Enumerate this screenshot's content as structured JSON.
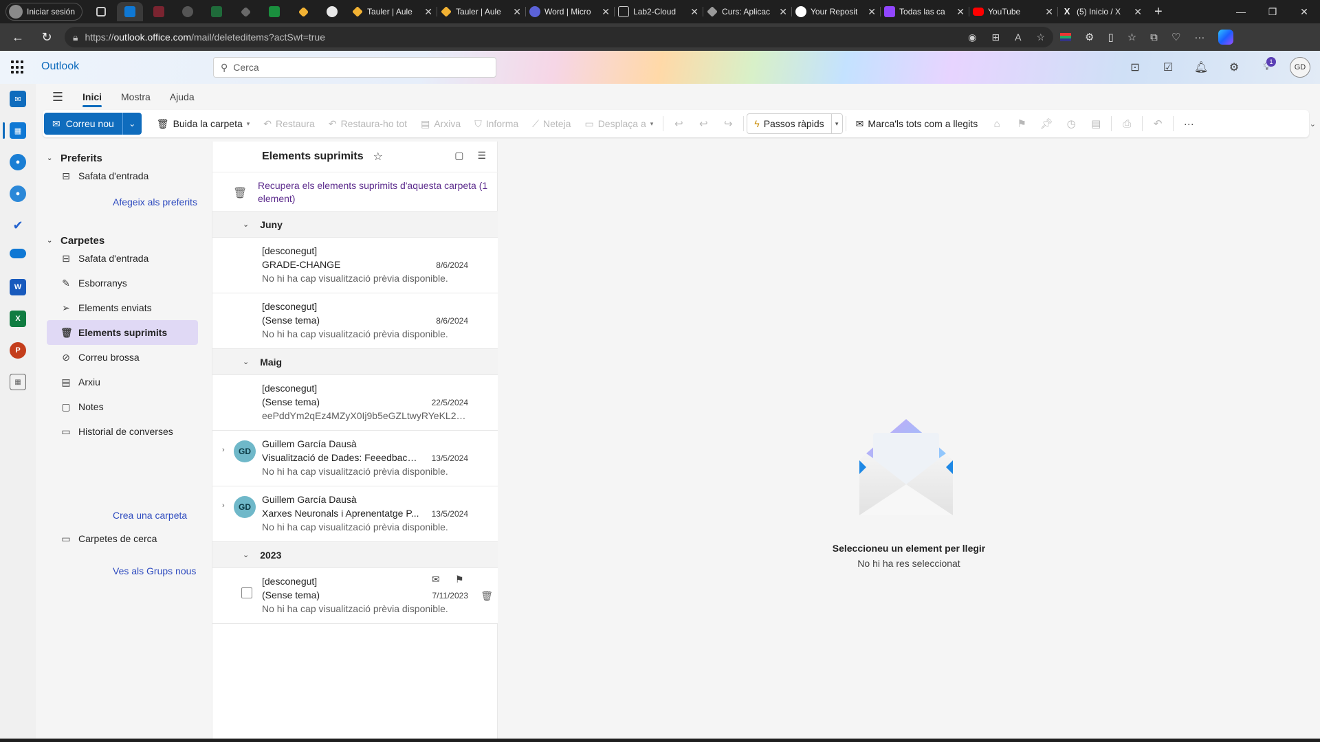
{
  "browser": {
    "profile_label": "Iniciar sesión",
    "tabs": [
      {
        "title": "Tauler | Aule",
        "icon": "diamond-icon",
        "color": "#f2b233"
      },
      {
        "title": "Tauler | Aule",
        "icon": "diamond-icon",
        "color": "#f2b233"
      },
      {
        "title": "Word | Micro",
        "icon": "copilot-icon",
        "color": "#5b62d8"
      },
      {
        "title": "Lab2-Cloud",
        "icon": "document-icon",
        "color": "#cfcfcf"
      },
      {
        "title": "Curs: Aplicac",
        "icon": "diamond-icon",
        "color": "#9a9a9a"
      },
      {
        "title": "Your Reposit",
        "icon": "github-icon",
        "color": "#ffffff"
      },
      {
        "title": "Todas las ca",
        "icon": "twitch-icon",
        "color": "#9146ff"
      },
      {
        "title": "YouTube",
        "icon": "youtube-icon",
        "color": "#ff0000"
      },
      {
        "title": "(5) Inicio / X",
        "icon": "x-icon",
        "color": "#ffffff"
      }
    ],
    "url_scheme": "https://",
    "url_host": "outlook.office.com",
    "url_path": "/mail/deleteditems?actSwt=true"
  },
  "outlook": {
    "app_name": "Outlook",
    "search_placeholder": "Cerca",
    "notification_count": "1",
    "user_initials": "GD",
    "ribbon_tabs": [
      "Inici",
      "Mostra",
      "Ajuda"
    ],
    "ribbon": {
      "new_mail": "Correu nou",
      "empty_folder": "Buida la carpeta",
      "restore": "Restaura",
      "restore_all": "Restaura-ho tot",
      "archive": "Arxiva",
      "report": "Informa",
      "sweep": "Neteja",
      "move_to": "Desplaça a",
      "quick_steps": "Passos ràpids",
      "mark_all_read": "Marca'ls tots com a llegits"
    },
    "folder_pane": {
      "favorites_header": "Preferits",
      "favorites": [
        {
          "label": "Safata d'entrada",
          "icon": "inbox-icon"
        }
      ],
      "add_favorite": "Afegeix als preferits",
      "folders_header": "Carpetes",
      "folders": [
        {
          "label": "Safata d'entrada",
          "icon": "inbox-icon"
        },
        {
          "label": "Esborranys",
          "icon": "pencil-icon"
        },
        {
          "label": "Elements enviats",
          "icon": "send-icon"
        },
        {
          "label": "Elements suprimits",
          "icon": "trash-icon"
        },
        {
          "label": "Correu brossa",
          "icon": "junk-icon"
        },
        {
          "label": "Arxiu",
          "icon": "archive-icon"
        },
        {
          "label": "Notes",
          "icon": "note-icon"
        },
        {
          "label": "Historial de converses",
          "icon": "folder-icon"
        }
      ],
      "create_folder": "Crea una carpeta",
      "search_folders": "Carpetes de cerca",
      "new_groups": "Ves als Grups nous"
    },
    "message_list": {
      "title": "Elements suprimits",
      "recover_text": "Recupera els elements suprimits d'aquesta carpeta (1 element)",
      "groups": [
        {
          "label": "Juny",
          "messages": [
            {
              "from": "[desconegut]",
              "subject": "GRADE-CHANGE",
              "date": "8/6/2024",
              "preview": "No hi ha cap visualització prèvia disponible."
            },
            {
              "from": "[desconegut]",
              "subject": "(Sense tema)",
              "date": "8/6/2024",
              "preview": "No hi ha cap visualització prèvia disponible."
            }
          ]
        },
        {
          "label": "Maig",
          "messages": [
            {
              "from": "[desconegut]",
              "subject": "(Sense tema)",
              "date": "22/5/2024",
              "preview": "eePddYm2qEz4MZyX0Ij9b5eGZLtwyRYeKL2url..."
            },
            {
              "from": "Guillem García Dausà",
              "subject": "Visualització de Dades: Feeedback i...",
              "date": "13/5/2024",
              "preview": "No hi ha cap visualització prèvia disponible.",
              "avatar": "GD"
            },
            {
              "from": "Guillem García Dausà",
              "subject": "Xarxes Neuronals i Aprenentatge P...",
              "date": "13/5/2024",
              "preview": "No hi ha cap visualització prèvia disponible.",
              "avatar": "GD"
            }
          ]
        },
        {
          "label": "2023",
          "messages": [
            {
              "from": "[desconegut]",
              "subject": "(Sense tema)",
              "date": "7/11/2023",
              "preview": "No hi ha cap visualització prèvia disponible."
            }
          ]
        }
      ]
    },
    "reading_pane": {
      "empty_title": "Seleccioneu un element per llegir",
      "empty_subtitle": "No hi ha res seleccionat"
    },
    "accent_color": "#0f6cbd"
  }
}
